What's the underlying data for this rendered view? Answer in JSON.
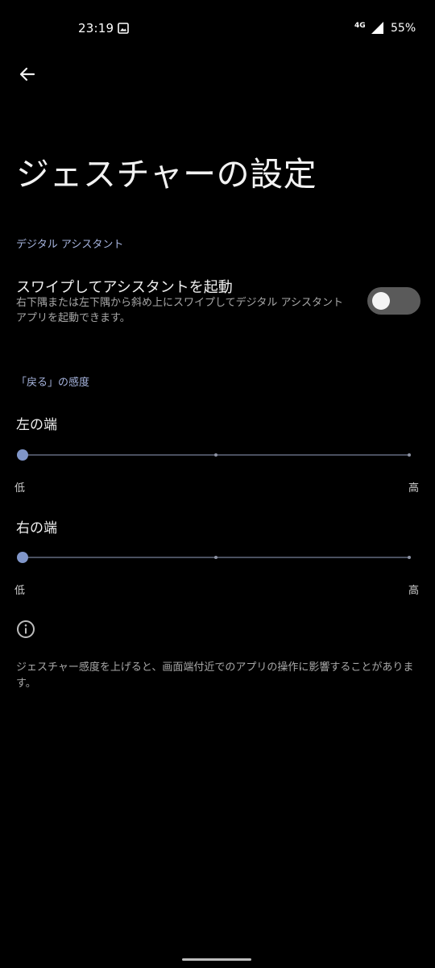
{
  "status_bar": {
    "time": "23:19",
    "network": "4G",
    "battery": "55%",
    "icons": [
      "gallery-icon",
      "signal-icon"
    ]
  },
  "header": {
    "back_icon": "arrow-left-icon",
    "title": "ジェスチャーの設定"
  },
  "digital_assistant": {
    "section_title": "デジタル アシスタント",
    "swipe_title": "スワイプしてアシスタントを起動",
    "swipe_summary": "右下隅または左下隅から斜め上にスワイプしてデジタル アシスタント アプリを起動できます。",
    "swipe_enabled": false
  },
  "back_sensitivity": {
    "section_title": "「戻る」の感度",
    "sliders": [
      {
        "label": "左の端",
        "low": "低",
        "high": "高",
        "value": 0,
        "steps": 3
      },
      {
        "label": "右の端",
        "low": "低",
        "high": "高",
        "value": 0,
        "steps": 3
      }
    ]
  },
  "footer": {
    "info_icon": "info-icon",
    "text": "ジェスチャー感度を上げると、画面端付近でのアプリの操作に影響することがあります。"
  },
  "colors": {
    "background": "#000000",
    "accent": "#a6b4de",
    "slider_thumb": "#8096c9",
    "toggle_track_off": "#5a5a5a"
  }
}
